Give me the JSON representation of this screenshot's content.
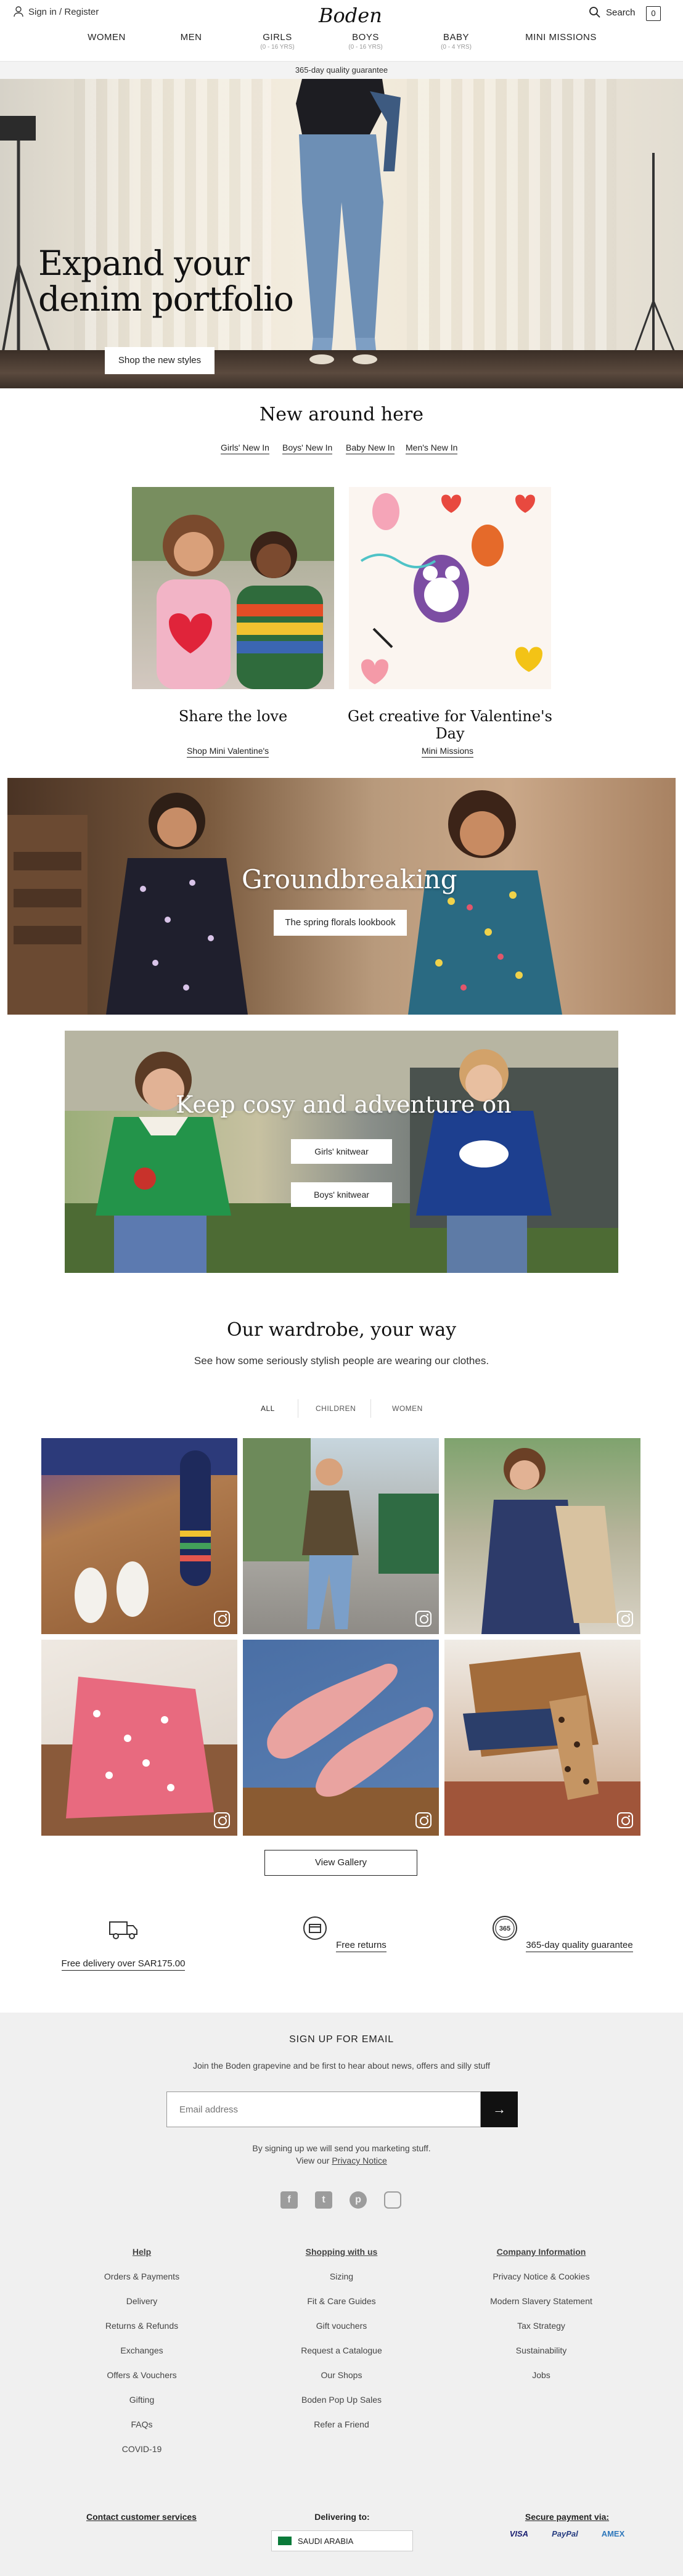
{
  "header": {
    "signin": "Sign in / Register",
    "logo": "Boden",
    "search": "Search",
    "bag_count": "0",
    "nav": [
      {
        "label": "WOMEN",
        "sub": ""
      },
      {
        "label": "MEN",
        "sub": ""
      },
      {
        "label": "GIRLS",
        "sub": "(0 - 16 YRS)"
      },
      {
        "label": "BOYS",
        "sub": "(0 - 16 YRS)"
      },
      {
        "label": "BABY",
        "sub": "(0 - 4 YRS)"
      },
      {
        "label": "MINI MISSIONS",
        "sub": ""
      }
    ],
    "guarantee": "365-day quality guarantee"
  },
  "hero": {
    "title_line1": "Expand your",
    "title_line2": "denim portfolio",
    "button": "Shop the new styles"
  },
  "new_around": {
    "title": "New around here",
    "links": [
      "Girls' New In",
      "Boys' New In",
      "Baby New In",
      "Men's New In"
    ],
    "tiles": [
      {
        "title": "Share the love",
        "link": "Shop Mini Valentine's"
      },
      {
        "title": "Get creative for Valentine's Day",
        "link": "Mini Missions"
      }
    ]
  },
  "groundbreaking": {
    "title": "Groundbreaking",
    "button": "The spring florals lookbook"
  },
  "cosy": {
    "title": "Keep cosy and adventure on",
    "buttons": [
      "Girls' knitwear",
      "Boys' knitwear"
    ]
  },
  "wardrobe": {
    "title": "Our wardrobe, your way",
    "subtitle": "See how some seriously stylish people are wearing our clothes.",
    "tabs": [
      "ALL",
      "CHILDREN",
      "WOMEN"
    ],
    "view_gallery": "View Gallery"
  },
  "usps": [
    {
      "label": "Free delivery over SAR175.00",
      "icon": "truck-icon"
    },
    {
      "label": "Free returns",
      "icon": "returns-icon"
    },
    {
      "label": "365-day quality guarantee",
      "icon": "guarantee-365-icon",
      "badge": "365"
    }
  ],
  "footer": {
    "signup_title": "SIGN UP FOR EMAIL",
    "signup_text": "Join the Boden grapevine and be first to hear about news, offers and silly stuff",
    "email_placeholder": "Email address",
    "disclaimer": "By signing up we will send you marketing stuff.",
    "view_our": "View our",
    "privacy_link": "Privacy Notice",
    "columns": [
      {
        "head": "Help",
        "links": [
          "Orders & Payments",
          "Delivery",
          "Returns & Refunds",
          "Exchanges",
          "Offers & Vouchers",
          "Gifting",
          "FAQs",
          "COVID-19"
        ]
      },
      {
        "head": "Shopping with us",
        "links": [
          "Sizing",
          "Fit & Care Guides",
          "Gift vouchers",
          "Request a Catalogue",
          "Our Shops",
          "Boden Pop Up Sales",
          "Refer a Friend"
        ]
      },
      {
        "head": "Company Information",
        "links": [
          "Privacy Notice & Cookies",
          "Modern Slavery Statement",
          "Tax Strategy",
          "Sustainability",
          "Jobs"
        ]
      }
    ],
    "contact": "Contact customer services",
    "delivering_to": "Delivering to:",
    "country": "SAUDI ARABIA",
    "secure_payment": "Secure payment via:",
    "payment_logos": [
      "VISA",
      "PayPal",
      "AMEX"
    ]
  },
  "colors": {
    "accent": "#111111",
    "footer_bg": "#f0f0f0",
    "bar_bg": "#f3f3f3"
  }
}
